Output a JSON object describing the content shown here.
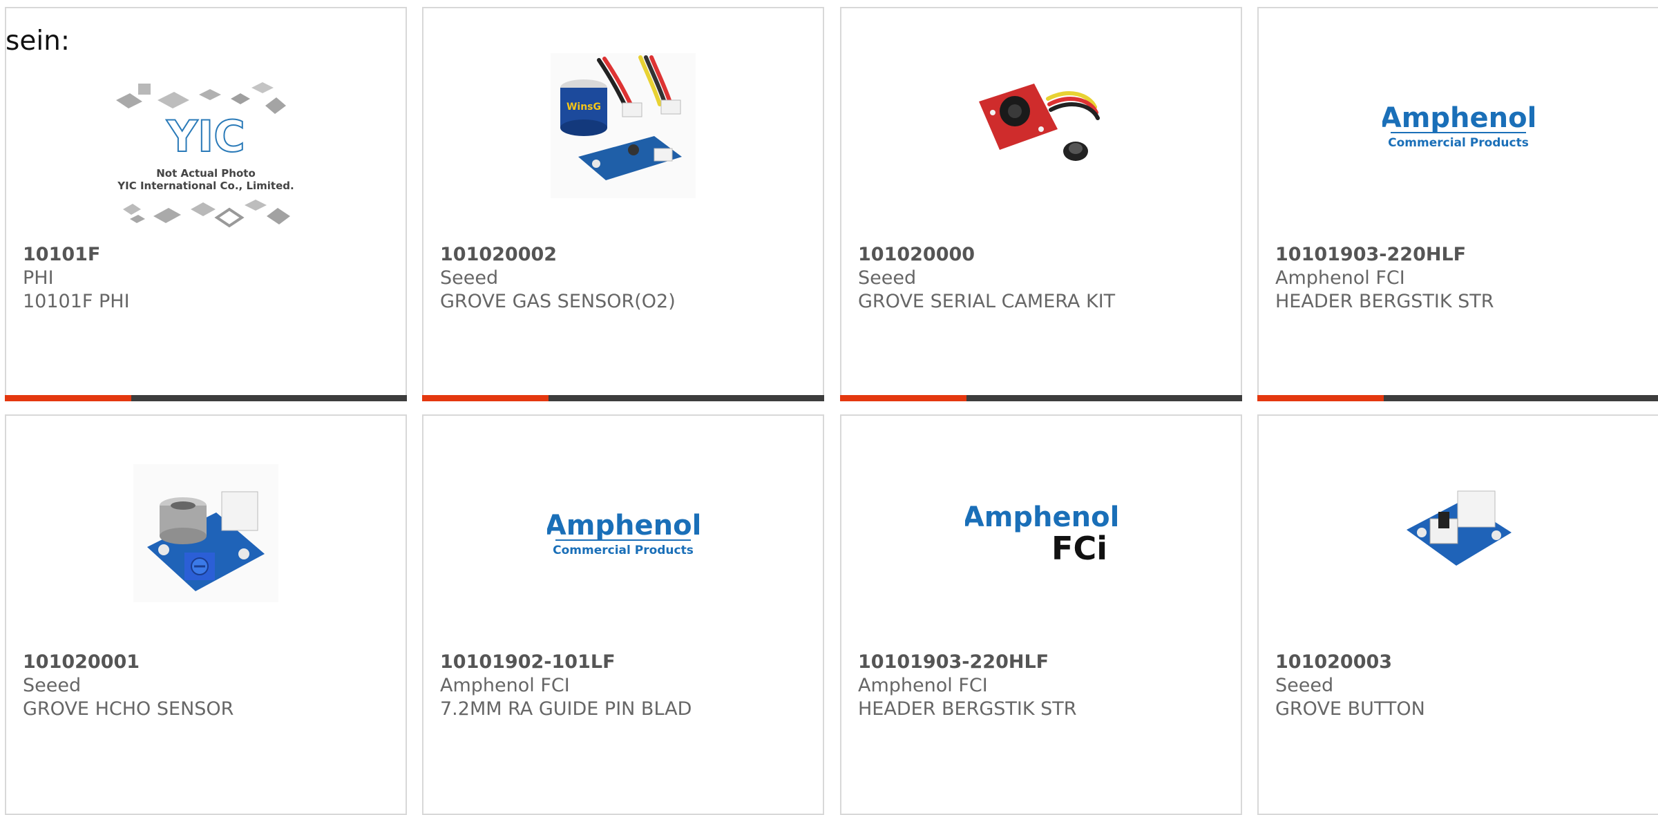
{
  "heading": "sein:",
  "colors": {
    "accent": "#e4380f",
    "bar": "#3d3d3d",
    "border": "#d8d8d8",
    "amphenol_blue": "#1a6fb8",
    "grove_blue": "#1f63b8",
    "camera_red": "#cc2a2a"
  },
  "products": [
    {
      "part": "10101F",
      "maker": "PHI",
      "desc": "10101F PHI",
      "image": "yic-placeholder-image",
      "image_caption_1": "Not Actual Photo",
      "image_caption_2": "YIC International Co., Limited.",
      "image_logo": "YIC"
    },
    {
      "part": "101020002",
      "maker": "Seeed",
      "desc": "GROVE GAS SENSOR(O2)",
      "image": "gas-sensor-image",
      "image_label": "WinsG"
    },
    {
      "part": "101020000",
      "maker": "Seeed",
      "desc": "GROVE SERIAL CAMERA KIT",
      "image": "camera-kit-image"
    },
    {
      "part": "10101903-220HLF",
      "maker": "Amphenol FCI",
      "desc": "HEADER BERGSTIK STR",
      "image": "amphenol-commercial-logo",
      "logo_main": "Amphenol",
      "logo_sub": "Commercial Products"
    },
    {
      "part": "101020001",
      "maker": "Seeed",
      "desc": "GROVE HCHO SENSOR",
      "image": "hcho-sensor-image"
    },
    {
      "part": "10101902-101LF",
      "maker": "Amphenol FCI",
      "desc": "7.2MM RA GUIDE PIN BLAD",
      "image": "amphenol-commercial-logo",
      "logo_main": "Amphenol",
      "logo_sub": "Commercial Products"
    },
    {
      "part": "10101903-220HLF",
      "maker": "Amphenol FCI",
      "desc": "HEADER BERGSTIK STR",
      "image": "amphenol-fci-logo",
      "logo_main": "Amphenol",
      "logo_sub": "FCi"
    },
    {
      "part": "101020003",
      "maker": "Seeed",
      "desc": "GROVE BUTTON",
      "image": "button-module-image"
    }
  ]
}
